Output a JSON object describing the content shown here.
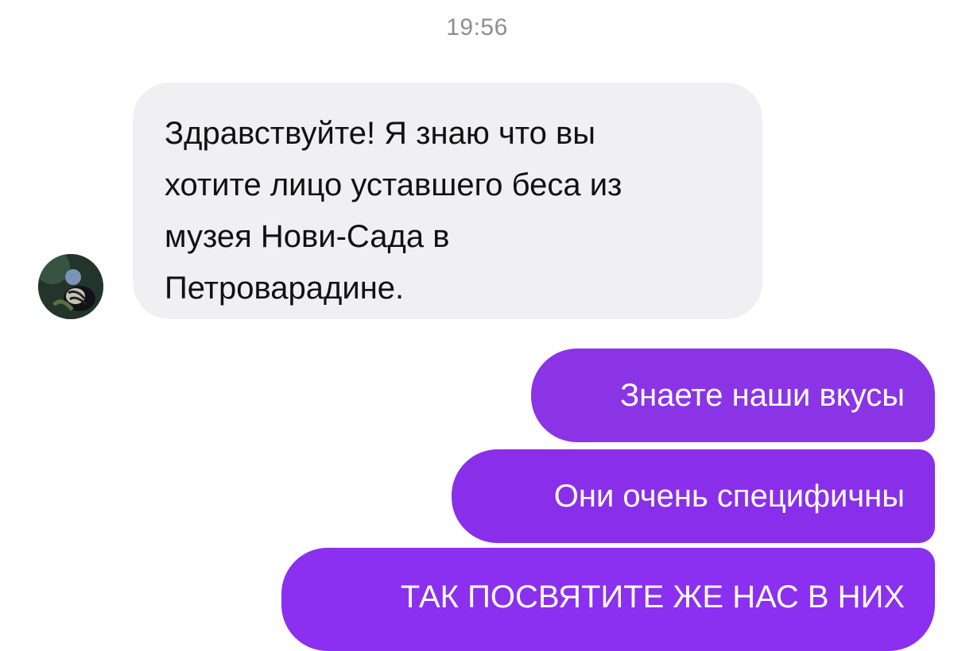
{
  "chat": {
    "timestamp": "19:56",
    "incoming": {
      "avatar_icon": "user-avatar",
      "text": "Здравствуйте! Я знаю что вы\nхотите лицо уставшего беса из\nмузея Нови-Сада в\nПетроварадине."
    },
    "outgoing": [
      {
        "text": "Знаете наши вкусы"
      },
      {
        "text": "Они очень специфичны"
      },
      {
        "text": "ТАК ПОСВЯТИТЕ ЖЕ НАС В НИХ"
      }
    ]
  },
  "colors": {
    "incoming_bubble": "#f0f0f2",
    "outgoing_bubble": "#8b2ff0",
    "timestamp": "#8e8e93"
  }
}
